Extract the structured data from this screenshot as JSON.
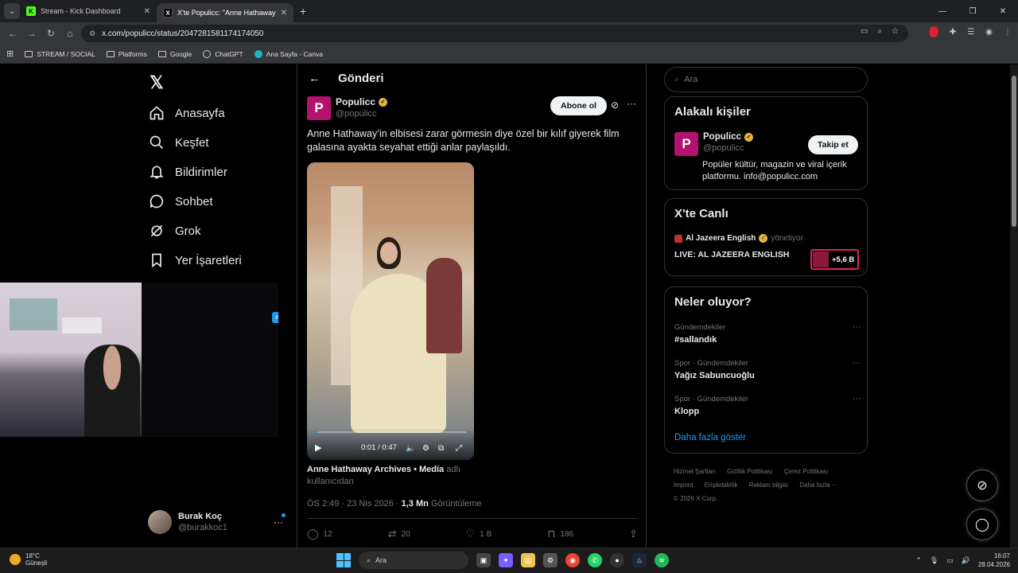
{
  "browser": {
    "tabs": [
      {
        "title": "Stream - Kick Dashboard",
        "favicon": "kick-icon"
      },
      {
        "title": "X'te Populicc: \"Anne Hathaway'",
        "favicon": "x-icon"
      }
    ],
    "url": "x.com/populicc/status/2047281581174174050",
    "bookmarks": [
      "STREAM / SOCIAL",
      "Platforms",
      "Google",
      "ChatGPT",
      "Ana Sayfa - Canva"
    ]
  },
  "nav": {
    "items": [
      {
        "label": "Anasayfa",
        "icon": "home-icon"
      },
      {
        "label": "Keşfet",
        "icon": "search-icon"
      },
      {
        "label": "Bildirimler",
        "icon": "bell-icon"
      },
      {
        "label": "Sohbet",
        "icon": "chat-icon"
      },
      {
        "label": "Grok",
        "icon": "grok-icon"
      },
      {
        "label": "Yer İşaretleri",
        "icon": "bookmark-icon"
      }
    ],
    "account": {
      "name": "Burak Koç",
      "handle": "@burakkoc1"
    }
  },
  "post": {
    "header": "Gönderi",
    "author": {
      "name": "Populicc",
      "handle": "@populicc",
      "avatar_letter": "P"
    },
    "subscribe_label": "Abone ol",
    "text": "Anne Hathaway’in elbisesi zarar görmesin diye özel bir kılıf giyerek film galasına ayakta seyahat ettiği anlar paylaşıldı.",
    "video": {
      "time": "0:01 / 0:47",
      "progress": 0.02
    },
    "attribution_source": "Anne Hathaway Archives • Media",
    "attribution_suffix": " adlı kullanıcıdan",
    "timestamp": "ÖS 2:49 · 23 Nis 2026 · ",
    "views": "1,3 Mn",
    "views_label": " Görüntüleme",
    "stats": {
      "replies": "12",
      "reposts": "20",
      "likes": "1 B",
      "bookmarks": "186"
    }
  },
  "sidebar": {
    "search_placeholder": "Ara",
    "related_title": "Alakalı kişiler",
    "related": {
      "name": "Populicc",
      "handle": "@populicc",
      "follow_label": "Takip et",
      "bio": "Popüler kültür, magazin ve viral içerik platformu. info@populicc.com"
    },
    "live_title": "X'te Canlı",
    "live": {
      "source": "Al Jazeera English",
      "role": "yönetiyor",
      "title": "LIVE: AL JAZEERA ENGLISH",
      "count": "+5,6 B"
    },
    "trends_title": "Neler oluyor?",
    "trends": [
      {
        "context": "Gündemdekiler",
        "topic": "#sallandık"
      },
      {
        "context": "Spor · Gündemdekiler",
        "topic": "Yağız Sabuncuoğlu"
      },
      {
        "context": "Spor · Gündemdekiler",
        "topic": "Klopp"
      }
    ],
    "show_more": "Daha fazla göster",
    "footer_line1": [
      "Hizmet Şartları",
      "Gizlilik Politikası",
      "Çerez Politikası"
    ],
    "footer_line2": [
      "İmprint",
      "Erişilebilirlik",
      "Reklam bilgisi",
      "Daha fazla ···"
    ],
    "copyright": "© 2026 X Corp."
  },
  "taskbar": {
    "weather_temp": "18°C",
    "weather_desc": "Güneşli",
    "search": "Ara",
    "time": "16:07",
    "date": "28.04.2026"
  },
  "colors": {
    "accent": "#1d9bf0",
    "brand_populicc": "#b3126f",
    "live_border": "#e0245e"
  }
}
